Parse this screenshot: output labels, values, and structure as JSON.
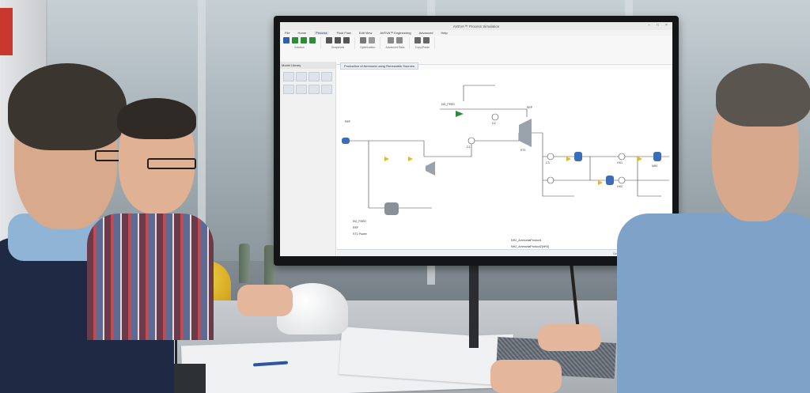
{
  "app": {
    "window_title": "AVEVA™ Process Simulation",
    "menu": [
      "File",
      "Home",
      "Process",
      "Fluid Flow",
      "Edit View",
      "AVEVA™ Engineering",
      "Advanced",
      "Help"
    ],
    "active_menu": "Process",
    "ribbon_groups": [
      "Solution",
      "Snapshots",
      "Optimization",
      "Advanced Data",
      "Copy/Paste"
    ],
    "document_tab": "Production of Ammonia using Renewable Sources",
    "sidebar_title": "Model Library",
    "status_overview": "Overview"
  },
  "flowsheet": {
    "labels": [
      "NG_FEED",
      "REF",
      "ST1",
      "SEP",
      "C1",
      "C2",
      "C3",
      "HX1",
      "HX2",
      "NH2",
      "V3",
      "V4",
      "V5",
      "K1",
      "K2",
      "K3",
      "PFL",
      "S1",
      "S2",
      "S3",
      "Q1",
      "Q2",
      "Q3",
      "ST1.Power",
      "NH3 Product"
    ],
    "summary_rows": [
      "NG_FEED",
      "REF",
      "ST1.Power",
      "NH2_AmmoniaProduct1",
      "NH2_AmmoniaProduct2(NH3)"
    ]
  },
  "colors": {
    "screen_bg": "#fbfbfb",
    "ribbon_green": "#2e8b3a",
    "stream_blue": "#1f4f9e",
    "valve_yellow": "#e4b72a",
    "vessel_blue": "#3a6fb8",
    "bezel": "#141516"
  },
  "icons": [
    "check-icon",
    "play-icon",
    "camera-icon",
    "gear-icon",
    "undo-icon",
    "redo-icon"
  ]
}
